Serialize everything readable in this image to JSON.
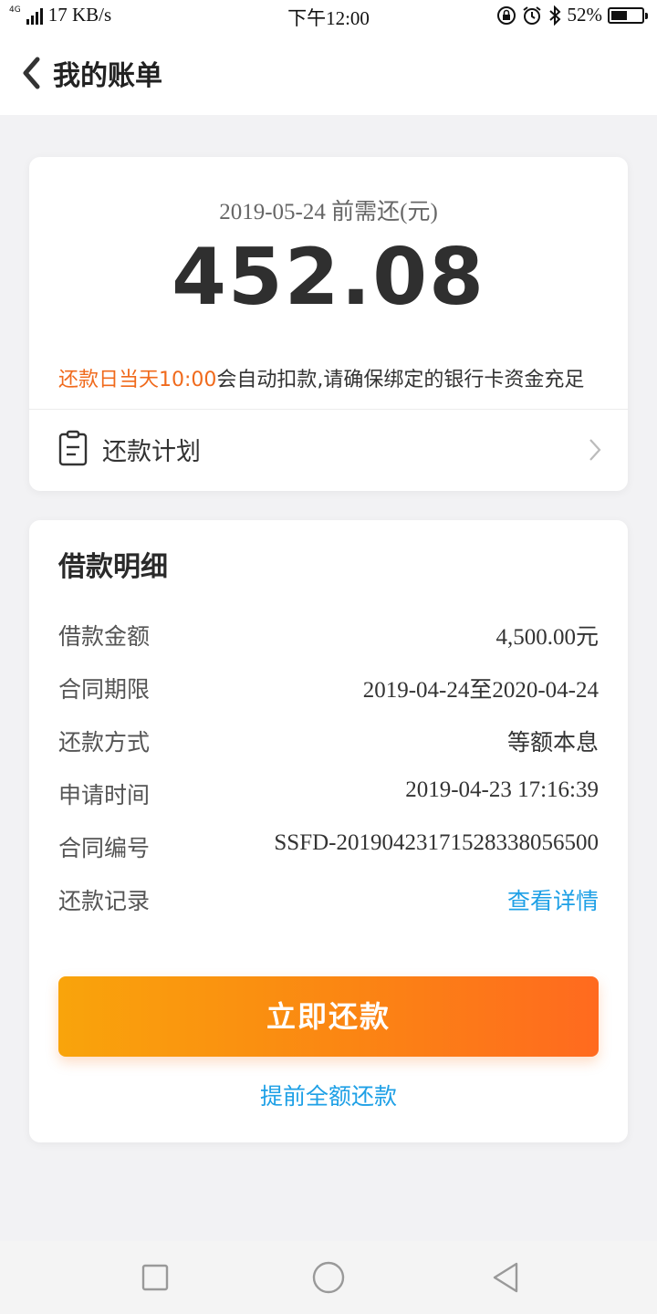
{
  "status_bar": {
    "network_tag": "4G",
    "speed": "17 KB/s",
    "time": "下午12:00",
    "battery": "52%",
    "battery_level": 0.52
  },
  "header": {
    "title": "我的账单"
  },
  "due": {
    "label": "2019-05-24 前需还(元)",
    "amount": "452.08",
    "notice_highlight": "还款日当天10:00",
    "notice_rest": "会自动扣款,请确保绑定的银行卡资金充足",
    "plan_label": "还款计划"
  },
  "detail": {
    "title": "借款明细",
    "rows": [
      {
        "key": "借款金额",
        "value": "4,500.00元"
      },
      {
        "key": "合同期限",
        "value": "2019-04-24至2020-04-24"
      },
      {
        "key": "还款方式",
        "value": "等额本息"
      },
      {
        "key": "申请时间",
        "value": "2019-04-23 17:16:39"
      },
      {
        "key": "合同编号",
        "value": "SSFD-20190423171528338056500"
      },
      {
        "key": "还款记录",
        "value": "查看详情"
      }
    ],
    "repay_button": "立即还款",
    "prepay_link": "提前全额还款"
  },
  "colors": {
    "accent_orange": "#f06a1c",
    "link_blue": "#1ea0e6",
    "button_gradient_start": "#f9a40b",
    "button_gradient_end": "#ff6a1f"
  }
}
